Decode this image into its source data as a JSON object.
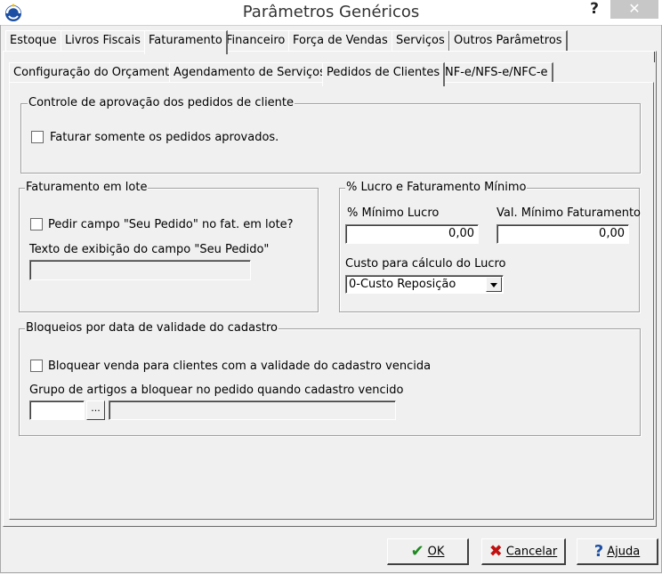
{
  "window": {
    "title": "Parâmetros Genéricos",
    "help": "?",
    "close": "✕"
  },
  "main_tabs": [
    {
      "label": "Estoque"
    },
    {
      "label": "Livros Fiscais"
    },
    {
      "label": "Faturamento"
    },
    {
      "label": "Financeiro"
    },
    {
      "label": "Força de Vendas"
    },
    {
      "label": "Serviços"
    },
    {
      "label": "Outros Parâmetros"
    }
  ],
  "sub_tabs": [
    {
      "label": "Configuração do Orçamento"
    },
    {
      "label": "Agendamento de Serviços"
    },
    {
      "label": "Pedidos de Clientes"
    },
    {
      "label": "NF-e/NFS-e/NFC-e"
    }
  ],
  "approval_group": {
    "legend": "Controle de aprovação dos pedidos de cliente",
    "checkbox_label": "Faturar somente os pedidos aprovados."
  },
  "batch_group": {
    "legend": "Faturamento em lote",
    "checkbox_label": "Pedir campo \"Seu Pedido\" no fat. em lote?",
    "text_label": "Texto de exibição do campo \"Seu Pedido\"",
    "text_value": ""
  },
  "profit_group": {
    "legend": "% Lucro e Faturamento Mínimo",
    "min_profit_label": "% Mínimo Lucro",
    "min_profit_value": "0,00",
    "min_billing_label": "Val. Mínimo Faturamento",
    "min_billing_value": "0,00",
    "cost_label": "Custo para cálculo do Lucro",
    "cost_selected": "0-Custo Reposição"
  },
  "block_group": {
    "legend": "Bloqueios por data de validade do cadastro",
    "checkbox_label": "Bloquear venda para clientes com a validade do cadastro vencida",
    "group_label": "Grupo de artigos a bloquear no pedido quando cadastro vencido",
    "code_value": "",
    "lookup_button": "...",
    "description_value": ""
  },
  "buttons": {
    "ok": "OK",
    "cancel": "Cancelar",
    "help": "Ajuda"
  }
}
